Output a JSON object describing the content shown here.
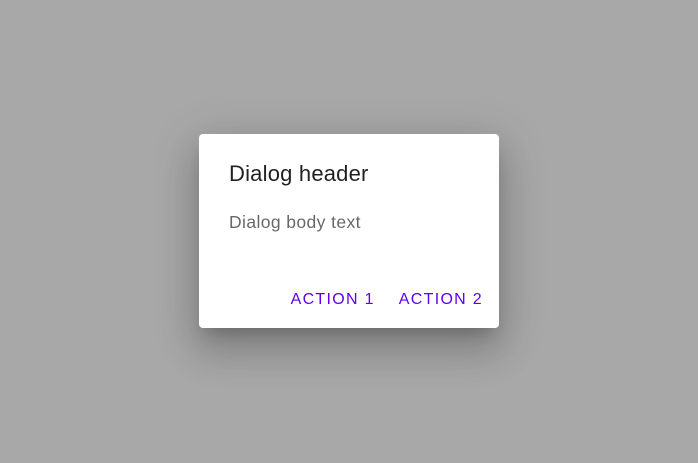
{
  "dialog": {
    "title": "Dialog header",
    "body": "Dialog body text",
    "actions": [
      {
        "label": "ACTION 1"
      },
      {
        "label": "ACTION 2"
      }
    ]
  },
  "colors": {
    "scrim": "#a8a8a8",
    "surface": "#ffffff",
    "primary": "#6200ee"
  }
}
